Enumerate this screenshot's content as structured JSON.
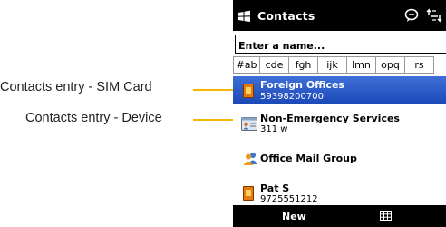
{
  "callouts": [
    {
      "text": "Contacts entry - SIM Card"
    },
    {
      "text": "Contacts entry - Device"
    }
  ],
  "titlebar": {
    "app_title": "Contacts",
    "start_icon": "windows-flag-icon",
    "notification_icon": "message-bubble-icon",
    "connectivity_icon": "connection-arrows-icon"
  },
  "search": {
    "placeholder": "Enter a name..."
  },
  "tabs": [
    "#ab",
    "cde",
    "fgh",
    "ijk",
    "lmn",
    "opq",
    "rs"
  ],
  "contacts": [
    {
      "name": "Foreign Offices",
      "detail": "59398200700",
      "type": "sim",
      "selected": true
    },
    {
      "name": "Non-Emergency Services",
      "detail": "311  w",
      "type": "device",
      "selected": false
    },
    {
      "name": "Office Mail Group",
      "detail": "",
      "type": "group",
      "selected": false
    },
    {
      "name": "Pat S",
      "detail": "9725551212",
      "type": "sim",
      "selected": false
    }
  ],
  "softkeys": {
    "left": "New",
    "right_icon": "menu-grid-icon"
  },
  "colors": {
    "selection": "#2456c4",
    "callout_line": "#f5b800",
    "sim_icon": "#e47a10",
    "bar": "#000000"
  }
}
